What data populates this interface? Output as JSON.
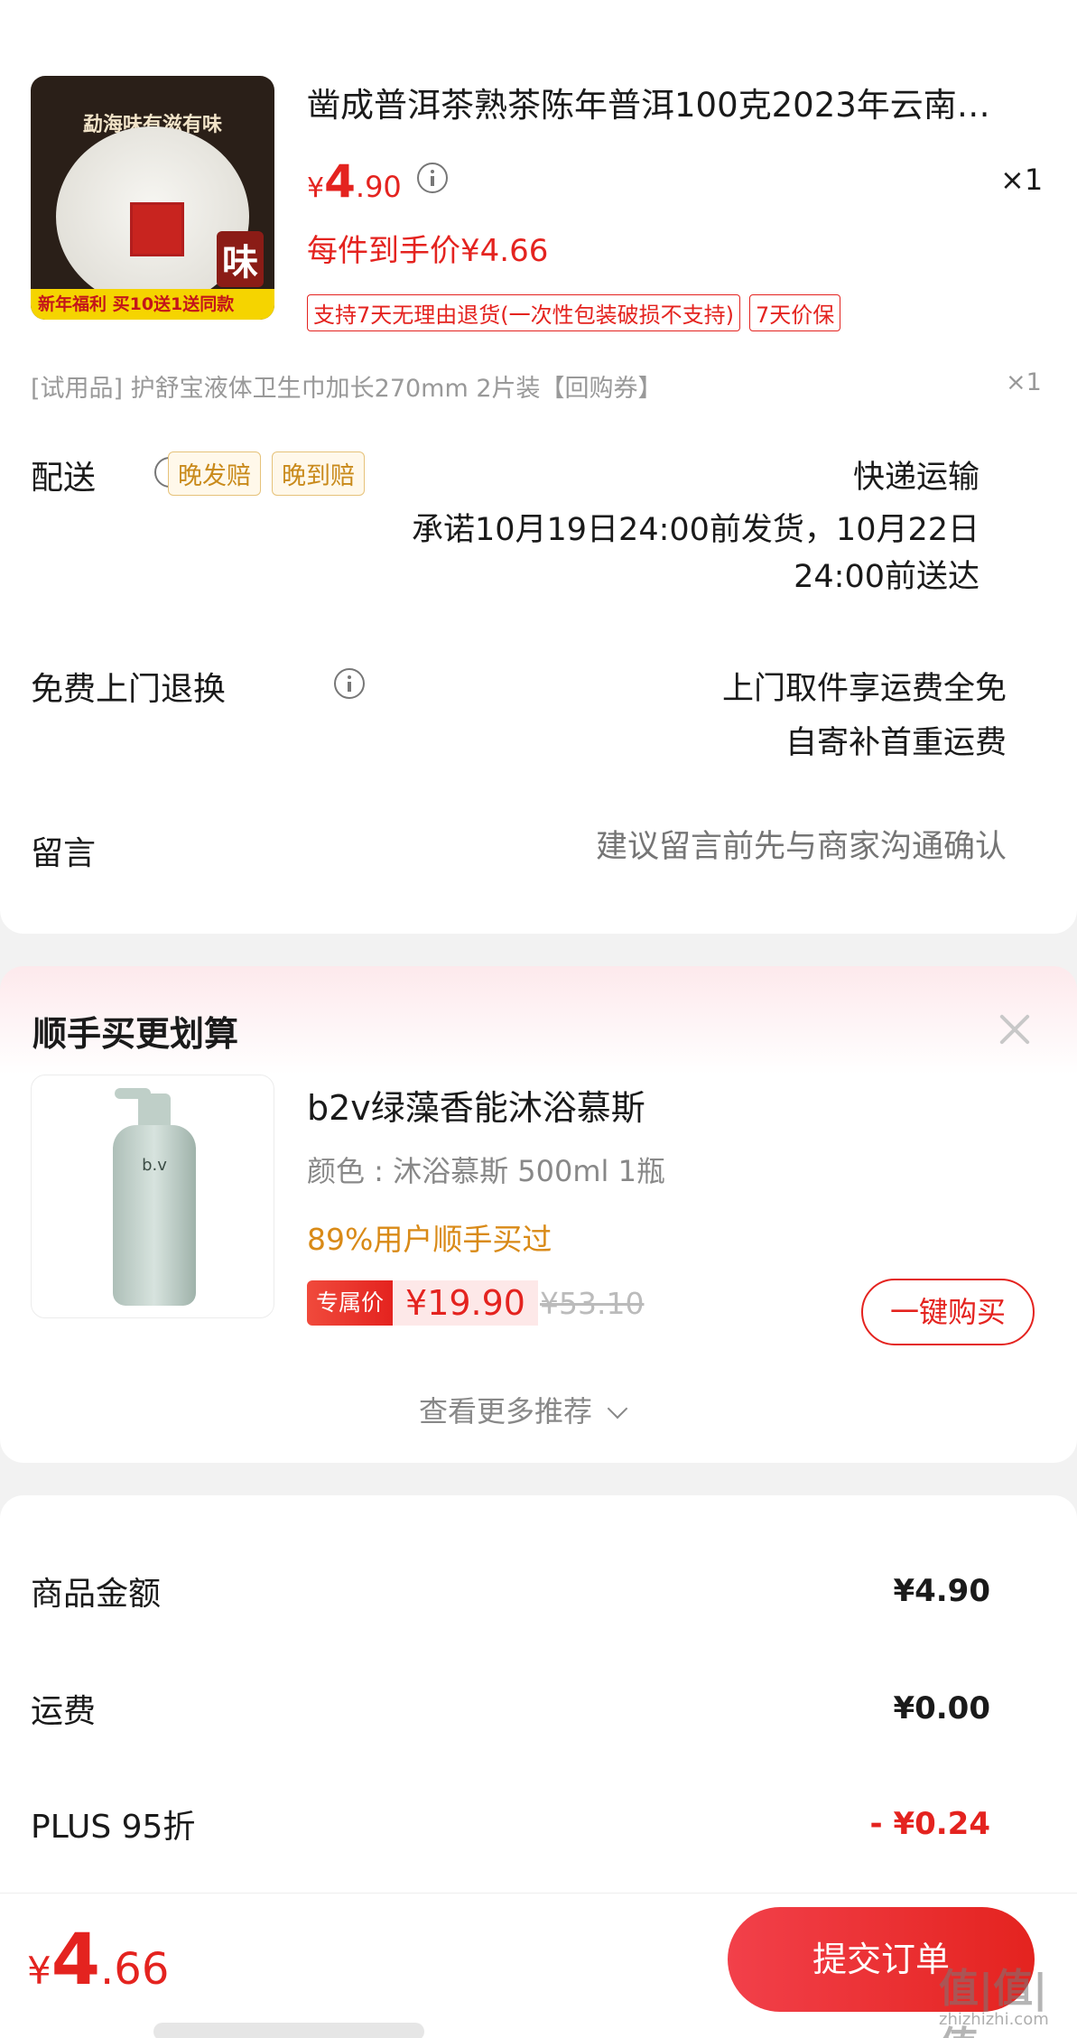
{
  "order_item": {
    "title": "凿成普洱茶熟茶陈年普洱100克2023年云南…",
    "price_symbol": "¥",
    "price_int": "4",
    "price_dec": ".90",
    "quantity": "×1",
    "final_price": "每件到手价¥4.66",
    "tags": [
      "支持7天无理由退货(一次性包装破损不支持)",
      "7天价保"
    ],
    "image": {
      "top_text": "勐海味有滋有味",
      "badge": "味",
      "strip": "新年福利 买10送1送同款"
    }
  },
  "gift_item": {
    "text": "[试用品]   护舒宝液体卫生巾加长270mm 2片装【回购券】",
    "quantity": "×1"
  },
  "delivery": {
    "label": "配送",
    "tags": [
      "晚发赔",
      "晚到赔"
    ],
    "method": "快递运输",
    "promise_line1": "承诺10月19日24:00前发货，10月22日",
    "promise_line2": "24:00前送达"
  },
  "return_service": {
    "label": "免费上门退换",
    "line1": "上门取件享运费全免",
    "line2": "自寄补首重运费"
  },
  "message": {
    "label": "留言",
    "placeholder": "建议留言前先与商家沟通确认"
  },
  "recommend": {
    "title": "顺手买更划算",
    "product_name": "b2v绿藻香能沐浴慕斯",
    "spec": "颜色 : 沐浴慕斯 500ml 1瓶",
    "social_proof": "89%用户顺手买过",
    "exclusive_label": "专属价",
    "exclusive_price": "¥19.90",
    "original_price": "¥53.10",
    "buy_label": "一键购买",
    "more_label": "查看更多推荐",
    "brand_mark": "b.v"
  },
  "summary": {
    "rows": [
      {
        "label": "商品金额",
        "value": "¥4.90"
      },
      {
        "label": "运费",
        "value": "¥0.00"
      },
      {
        "label": "PLUS 95折",
        "value": "- ¥0.24"
      }
    ]
  },
  "bottom": {
    "total_symbol": "¥",
    "total_int": "4",
    "total_dec": ".66",
    "submit_label": "提交订单",
    "watermark": "值|值|值",
    "watermark_url": "zhizhizhi.com"
  },
  "colors": {
    "accent": "#e4231f",
    "gold": "#c98a1b",
    "background": "#f2f2f2"
  }
}
